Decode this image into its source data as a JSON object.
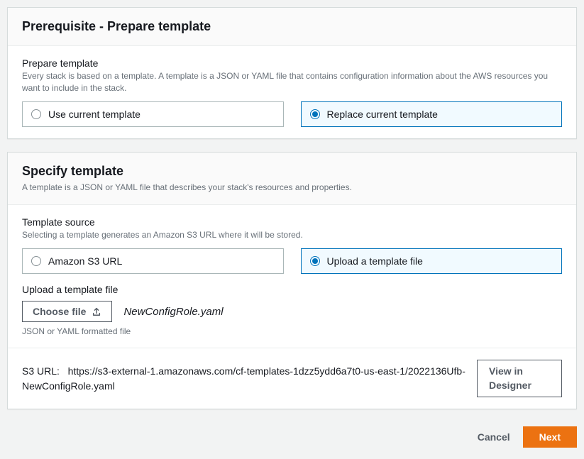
{
  "prereq": {
    "title": "Prerequisite - Prepare template",
    "prepare_label": "Prepare template",
    "prepare_hint": "Every stack is based on a template. A template is a JSON or YAML file that contains configuration information about the AWS resources you want to include in the stack.",
    "option_use_current": "Use current template",
    "option_replace": "Replace current template"
  },
  "specify": {
    "title": "Specify template",
    "subtitle": "A template is a JSON or YAML file that describes your stack's resources and properties.",
    "source_label": "Template source",
    "source_hint": "Selecting a template generates an Amazon S3 URL where it will be stored.",
    "option_s3": "Amazon S3 URL",
    "option_upload": "Upload a template file",
    "upload_label": "Upload a template file",
    "choose_file": "Choose file",
    "filename": "NewConfigRole.yaml",
    "file_hint": "JSON or YAML formatted file",
    "s3_label": "S3 URL:",
    "s3_url": "https://s3-external-1.amazonaws.com/cf-templates-1dzz5ydd6a7t0-us-east-1/2022136Ufb-NewConfigRole.yaml",
    "view_designer": "View in Designer"
  },
  "footer": {
    "cancel": "Cancel",
    "next": "Next"
  }
}
